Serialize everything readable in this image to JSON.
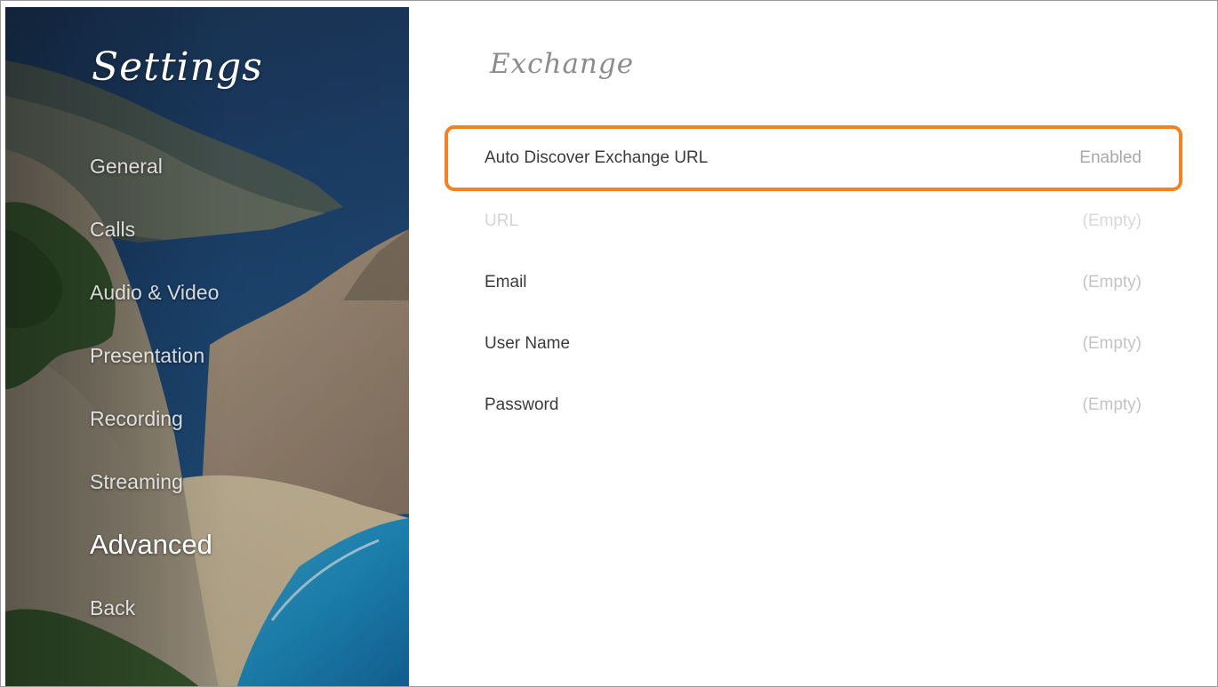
{
  "sidebar": {
    "title": "Settings",
    "items": [
      {
        "label": "General",
        "active": false
      },
      {
        "label": "Calls",
        "active": false
      },
      {
        "label": "Audio & Video",
        "active": false
      },
      {
        "label": "Presentation",
        "active": false
      },
      {
        "label": "Recording",
        "active": false
      },
      {
        "label": "Streaming",
        "active": false
      },
      {
        "label": "Advanced",
        "active": true
      },
      {
        "label": "Back",
        "active": false
      }
    ]
  },
  "main": {
    "title": "Exchange",
    "settings": [
      {
        "label": "Auto Discover Exchange URL",
        "value": "Enabled",
        "state": "selected"
      },
      {
        "label": "URL",
        "value": "(Empty)",
        "state": "disabled"
      },
      {
        "label": "Email",
        "value": "(Empty)",
        "state": "normal"
      },
      {
        "label": "User Name",
        "value": "(Empty)",
        "state": "normal"
      },
      {
        "label": "Password",
        "value": "(Empty)",
        "state": "normal"
      }
    ]
  },
  "colors": {
    "accent": "#f58220",
    "title": "#8c8c8c",
    "label": "#3b3b3b",
    "value": "#c4c4c4"
  }
}
